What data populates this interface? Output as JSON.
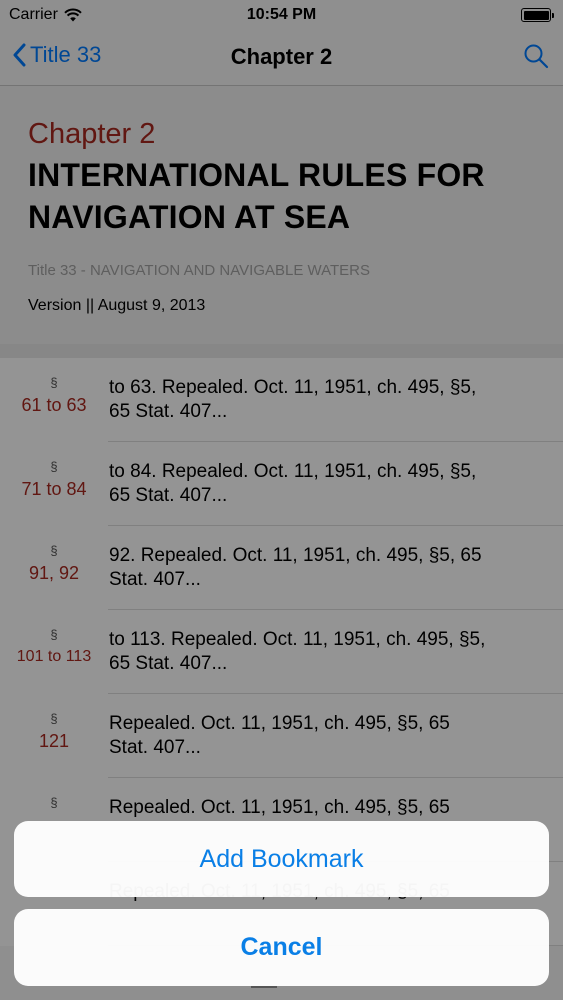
{
  "status_bar": {
    "carrier": "Carrier",
    "time": "10:54 PM"
  },
  "nav": {
    "back_label": "Title 33",
    "title": "Chapter 2"
  },
  "header": {
    "chapter_label": "Chapter 2",
    "chapter_title_line1": "INTERNATIONAL RULES FOR",
    "chapter_title_line2": "NAVIGATION AT SEA",
    "title_sub": "Title 33 - NAVIGATION AND NAVIGABLE WATERS",
    "version": "Version || August 9, 2013"
  },
  "list": [
    {
      "symbol": "§",
      "number": "61 to 63",
      "line1": "to 63. Repealed. Oct. 11, 1951, ch. 495, §5,",
      "line2": "65 Stat. 407..."
    },
    {
      "symbol": "§",
      "number": "71 to 84",
      "line1": "to 84. Repealed. Oct. 11, 1951, ch. 495, §5,",
      "line2": "65 Stat. 407..."
    },
    {
      "symbol": "§",
      "number": "91, 92",
      "line1": "92. Repealed. Oct. 11, 1951, ch. 495, §5, 65",
      "line2": "Stat. 407..."
    },
    {
      "symbol": "§",
      "number": "101 to 113",
      "line1": "to 113. Repealed. Oct. 11, 1951, ch. 495, §5,",
      "line2": "65 Stat. 407..."
    },
    {
      "symbol": "§",
      "number": "121",
      "line1": "Repealed. Oct. 11, 1951, ch. 495, §5, 65",
      "line2": "Stat. 407..."
    },
    {
      "symbol": "§",
      "number": "",
      "line1": "Repealed. Oct. 11, 1951, ch. 495, §5, 65",
      "line2": ""
    },
    {
      "symbol": "",
      "number": "",
      "line1": "Repealed. Oct. 11, 1951, ch. 495, §5, 65",
      "line2": ""
    }
  ],
  "action_sheet": {
    "add_bookmark": "Add Bookmark",
    "cancel": "Cancel"
  }
}
